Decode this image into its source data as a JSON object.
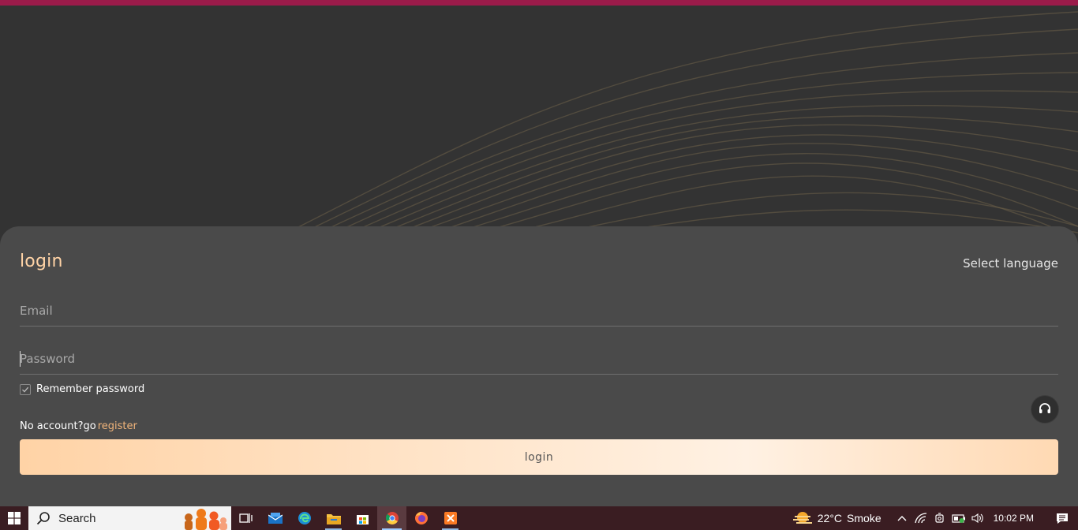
{
  "login": {
    "title": "login",
    "language_label": "Select language",
    "email_placeholder": "Email",
    "password_placeholder": "Password",
    "remember_label": "Remember password",
    "remember_checked": true,
    "no_account_text": "No account?go",
    "register_link": "register",
    "login_button": "login"
  },
  "colors": {
    "accent_top": "#9b1b4a",
    "title": "#ffd3a6",
    "link": "#f0b47a",
    "button_gradient_start": "#ffd3a6",
    "button_gradient_end": "#fff1e3"
  },
  "taskbar": {
    "search_placeholder": "Search",
    "apps": [
      "task-view-icon",
      "mail-icon",
      "edge-icon",
      "file-explorer-icon",
      "store-icon",
      "chrome-icon",
      "firefox-icon",
      "xampp-icon"
    ],
    "weather_temp": "22°C",
    "weather_text": "Smoke",
    "time": "10:02 PM"
  }
}
